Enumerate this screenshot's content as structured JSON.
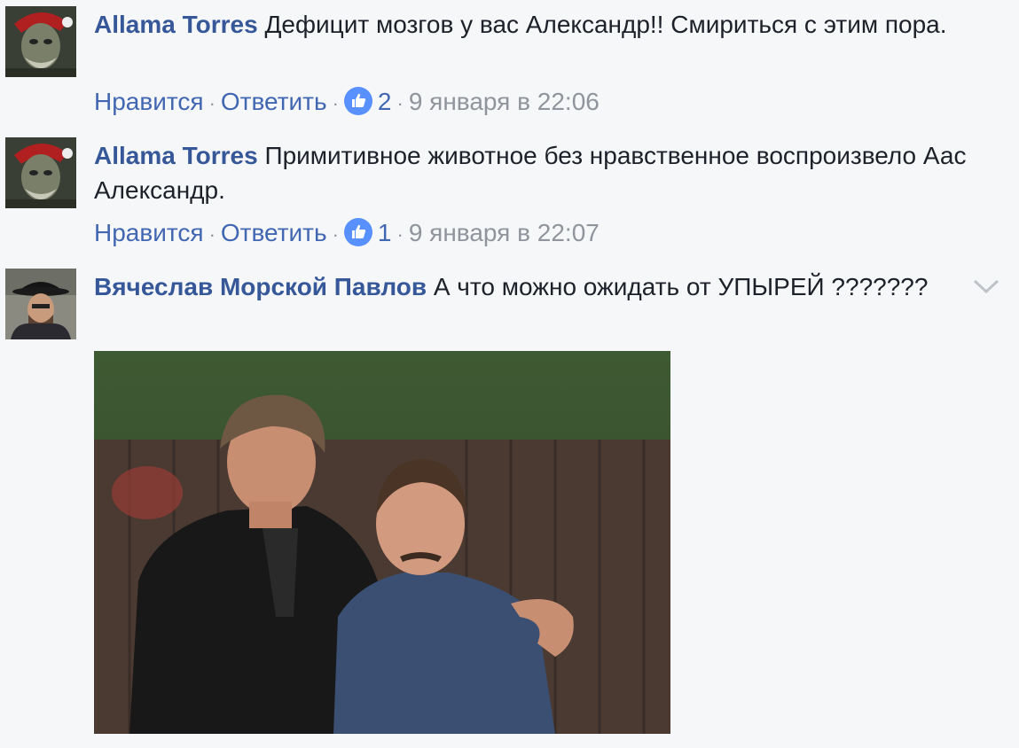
{
  "comments": [
    {
      "author": "Allama Torres",
      "text": "Дефицит мозгов у вас Александр!! Смириться с этим пора.",
      "like_label": "Нравится",
      "reply_label": "Ответить",
      "like_count": "2",
      "timestamp": "9 января в 22:06"
    },
    {
      "author": "Allama Torres",
      "text": "Примитивное животное без нравственное воспроизвело Аас Александр.",
      "like_label": "Нравится",
      "reply_label": "Ответить",
      "like_count": "1",
      "timestamp": "9 января в 22:07"
    },
    {
      "author": "Вячеслав Морской Павлов",
      "text": "А что можно ожидать от УПЫРЕЙ ???????"
    }
  ],
  "icons": {
    "like": "thumbs-up-icon",
    "options": "chevron-down-icon"
  },
  "colors": {
    "author": "#365899",
    "link": "#4267b2",
    "meta": "#90949c",
    "like_badge": "#5890ff",
    "background": "#f6f7f9"
  }
}
